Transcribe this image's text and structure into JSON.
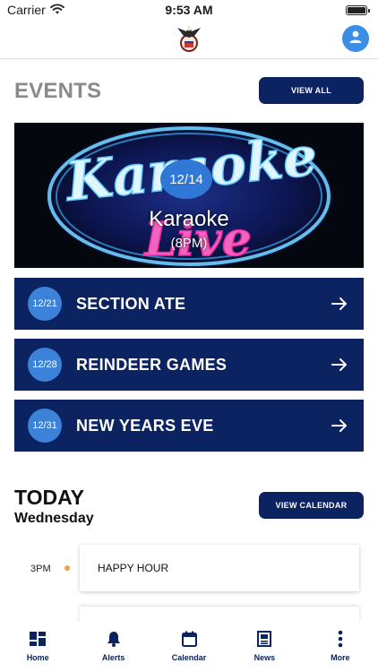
{
  "status_bar": {
    "carrier": "Carrier",
    "time": "9:53 AM",
    "icons": [
      "wifi-icon",
      "battery-icon"
    ]
  },
  "header": {
    "logo": "eagle-logo",
    "profile_icon": "user-icon",
    "accent_color": "#3b8ee4"
  },
  "events": {
    "title": "EVENTS",
    "view_all_label": "VIEW ALL",
    "featured": {
      "date": "12/14",
      "name": "Karaoke",
      "time": "(8PM)",
      "image_text": [
        "Karaoke",
        "Live"
      ]
    },
    "items": [
      {
        "date": "12/21",
        "title": "SECTION ATE"
      },
      {
        "date": "12/28",
        "title": "REINDEER GAMES"
      },
      {
        "date": "12/31",
        "title": "NEW YEARS EVE"
      }
    ],
    "arrow_icon": "arrow-right-icon"
  },
  "today": {
    "title": "TODAY",
    "day": "Wednesday",
    "view_calendar_label": "VIEW CALENDAR",
    "schedule": [
      {
        "time": "3PM",
        "title": "HAPPY HOUR"
      }
    ]
  },
  "tab_bar": {
    "tabs": [
      {
        "label": "Home",
        "icon": "home-grid-icon"
      },
      {
        "label": "Alerts",
        "icon": "bell-icon"
      },
      {
        "label": "Calendar",
        "icon": "calendar-icon"
      },
      {
        "label": "News",
        "icon": "newspaper-icon"
      },
      {
        "label": "More",
        "icon": "more-vertical-icon"
      }
    ]
  },
  "colors": {
    "navy": "#0b2361",
    "date_badge": "#3b82d8",
    "time_dot": "#f0a04b",
    "section_grey": "#8a8a8a"
  }
}
